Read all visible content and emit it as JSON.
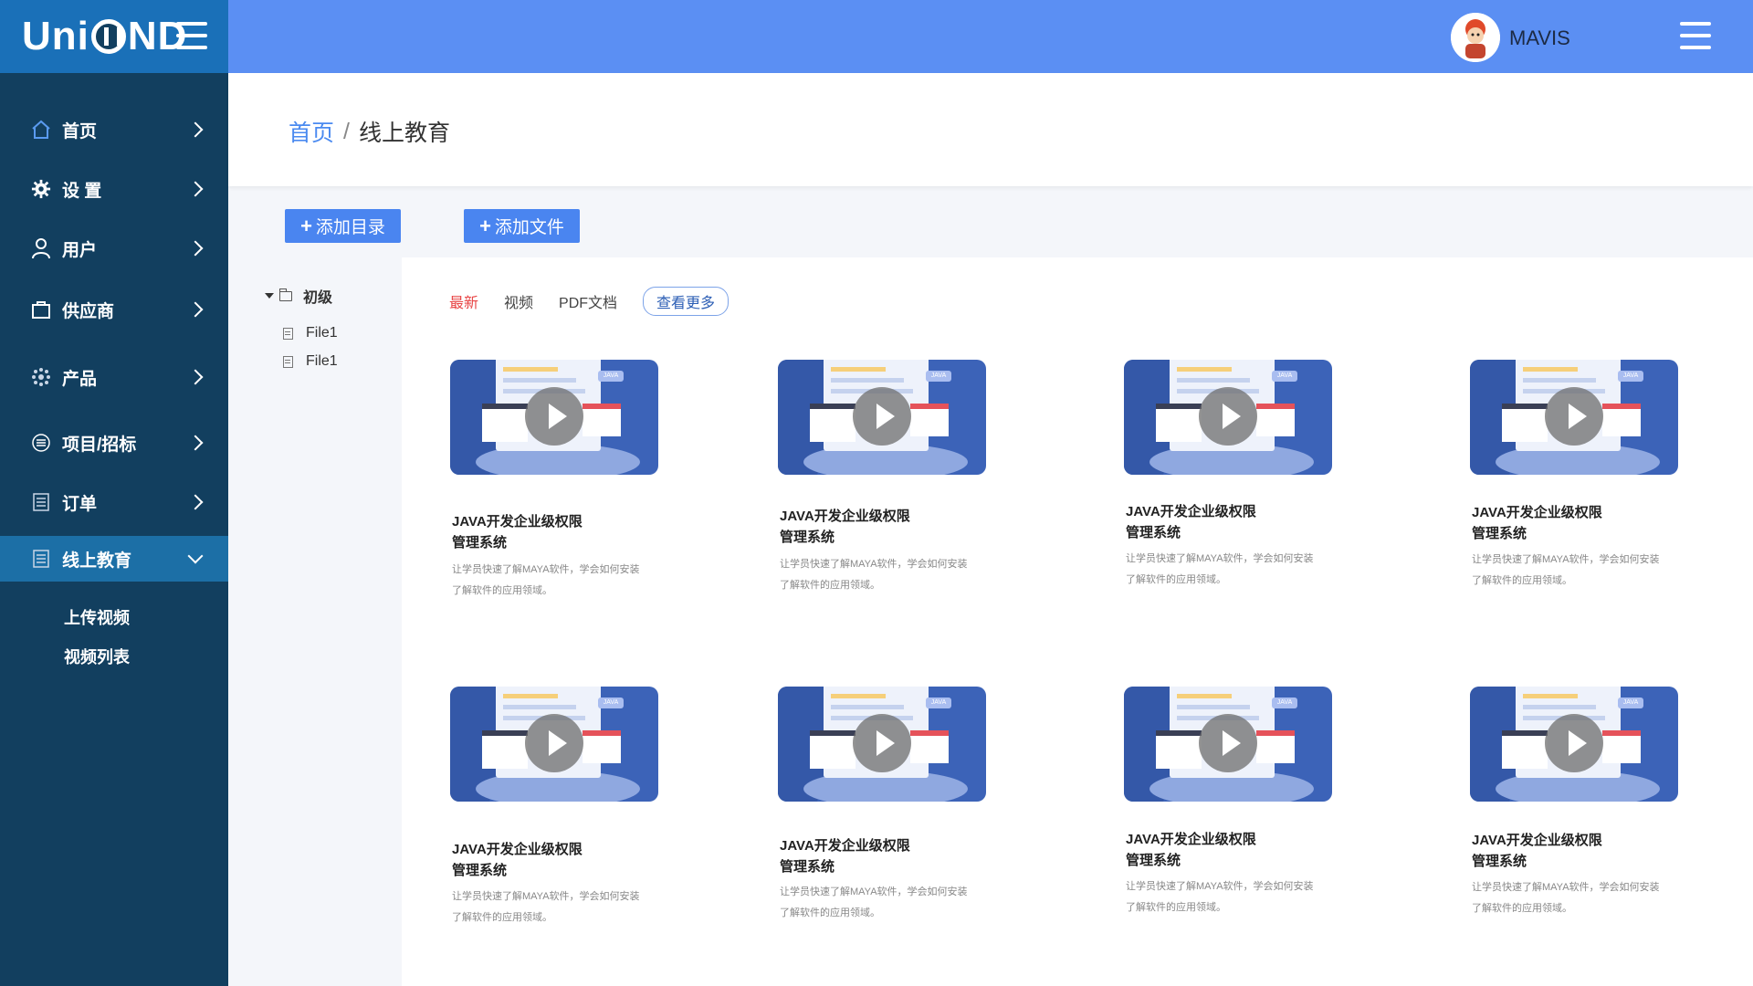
{
  "app": {
    "logo_text_left": "U",
    "logo_text_right": "ND",
    "logo_mid": "ni"
  },
  "sidebar": {
    "items": [
      {
        "label": "首页",
        "icon": "home-icon"
      },
      {
        "label": "设 置",
        "icon": "gear-icon"
      },
      {
        "label": "用户",
        "icon": "user-icon"
      },
      {
        "label": "供应商",
        "icon": "bag-icon"
      },
      {
        "label": "产品",
        "icon": "product-icon"
      },
      {
        "label": "项目/招标",
        "icon": "list-circle-icon"
      },
      {
        "label": "订单",
        "icon": "order-icon"
      },
      {
        "label": "线上教育",
        "icon": "education-icon",
        "active": true
      }
    ],
    "submenu": [
      {
        "label": "上传视频"
      },
      {
        "label": "视频列表"
      }
    ]
  },
  "topbar": {
    "username": "MAVIS"
  },
  "breadcrumb": {
    "home": "首页",
    "separator": "/",
    "current": "线上教育"
  },
  "actions": {
    "add_folder": "添加目录",
    "add_file": "添加文件"
  },
  "tree": {
    "root": "初级",
    "files": [
      "File1",
      "File1"
    ]
  },
  "tabs": [
    {
      "label": "最新",
      "active": true
    },
    {
      "label": "视频"
    },
    {
      "label": "PDF文档"
    },
    {
      "label": "查看更多"
    }
  ],
  "cards": [
    {
      "title_line1": "JAVA开发企业级权限",
      "title_line2": "管理系统",
      "desc_line1": "让学员快速了解MAYA软件，学会如何安装",
      "desc_line2": "了解软件的应用领域。",
      "tag": "JAVA"
    },
    {
      "title_line1": "JAVA开发企业级权限",
      "title_line2": "管理系统",
      "desc_line1": "让学员快速了解MAYA软件，学会如何安装",
      "desc_line2": "了解软件的应用领域。",
      "tag": "JAVA"
    },
    {
      "title_line1": "JAVA开发企业级权限",
      "title_line2": "管理系统",
      "desc_line1": "让学员快速了解MAYA软件，学会如何安装",
      "desc_line2": "了解软件的应用领域。",
      "tag": "JAVA"
    },
    {
      "title_line1": "JAVA开发企业级权限",
      "title_line2": "管理系统",
      "desc_line1": "让学员快速了解MAYA软件，学会如何安装",
      "desc_line2": "了解软件的应用领域。",
      "tag": "JAVA"
    },
    {
      "title_line1": "JAVA开发企业级权限",
      "title_line2": "管理系统",
      "desc_line1": "让学员快速了解MAYA软件，学会如何安装",
      "desc_line2": "了解软件的应用领域。",
      "tag": "JAVA"
    },
    {
      "title_line1": "JAVA开发企业级权限",
      "title_line2": "管理系统",
      "desc_line1": "让学员快速了解MAYA软件，学会如何安装",
      "desc_line2": "了解软件的应用领域。",
      "tag": "JAVA"
    },
    {
      "title_line1": "JAVA开发企业级权限",
      "title_line2": "管理系统",
      "desc_line1": "让学员快速了解MAYA软件，学会如何安装",
      "desc_line2": "了解软件的应用领域。",
      "tag": "JAVA"
    },
    {
      "title_line1": "JAVA开发企业级权限",
      "title_line2": "管理系统",
      "desc_line1": "让学员快速了解MAYA软件，学会如何安装",
      "desc_line2": "了解软件的应用领域。",
      "tag": "JAVA"
    }
  ],
  "colors": {
    "sidebar": "#123f5f",
    "logo_bar": "#1a70b8",
    "topbar": "#5b8ff3",
    "accent": "#4a85f0",
    "active_tab": "#e84545"
  }
}
